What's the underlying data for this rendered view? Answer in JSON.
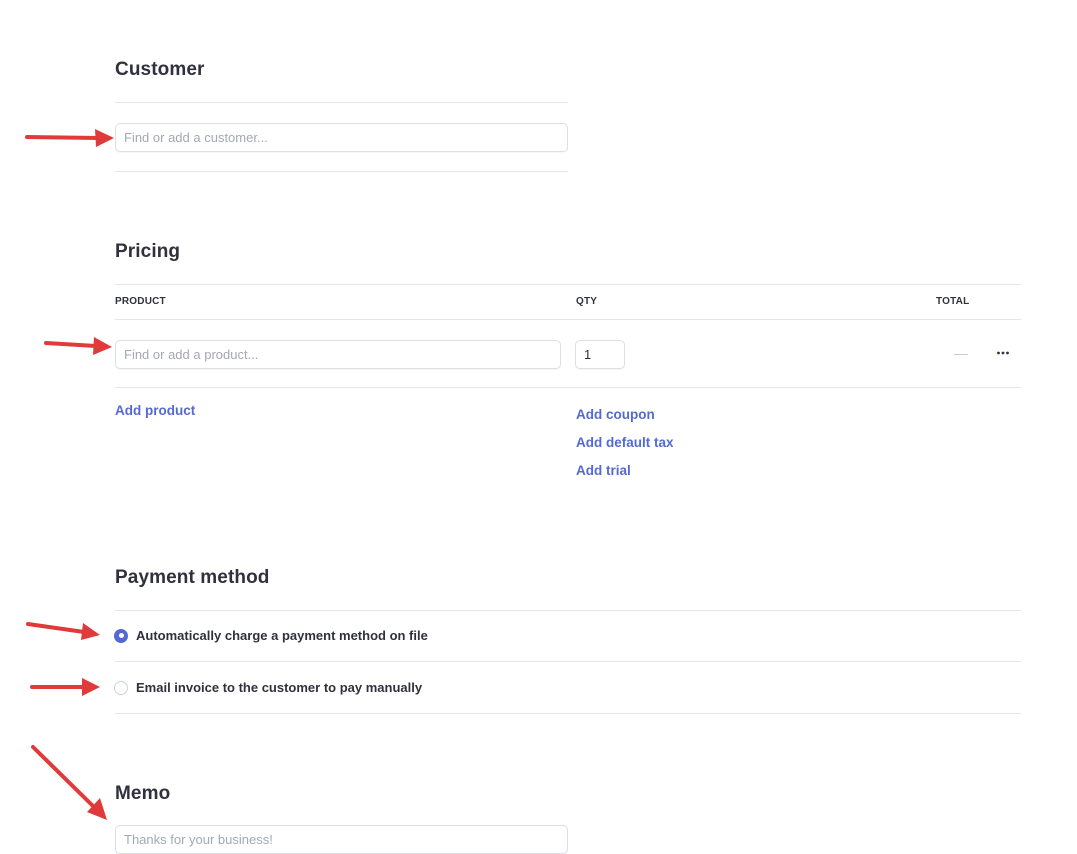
{
  "customer": {
    "title": "Customer",
    "input_placeholder": "Find or add a customer..."
  },
  "pricing": {
    "title": "Pricing",
    "columns": {
      "product": "PRODUCT",
      "qty": "QTY",
      "total": "TOTAL"
    },
    "row": {
      "product_placeholder": "Find or add a product...",
      "qty_value": "1",
      "total_value": "—"
    },
    "add_product": "Add product",
    "links": [
      "Add coupon",
      "Add default tax",
      "Add trial"
    ]
  },
  "payment_method": {
    "title": "Payment method",
    "options": [
      {
        "label": "Automatically charge a payment method on file",
        "selected": true
      },
      {
        "label": "Email invoice to the customer to pay manually",
        "selected": false
      }
    ]
  },
  "memo": {
    "title": "Memo",
    "input_placeholder": "Thanks for your business!"
  },
  "colors": {
    "accent": "#5469d4",
    "annotation_arrow": "#e03a3a",
    "text": "#30313d",
    "placeholder": "#a3a8b4",
    "divider": "#e3e6ea"
  }
}
